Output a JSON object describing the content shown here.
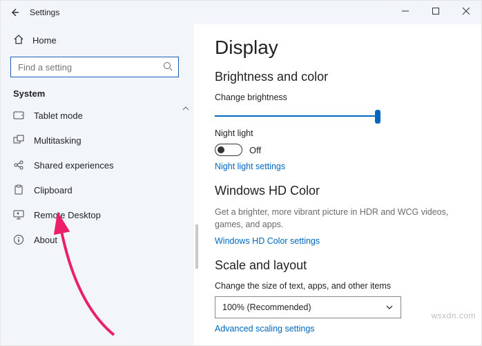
{
  "titlebar": {
    "title": "Settings"
  },
  "left": {
    "home_label": "Home",
    "search_placeholder": "Find a setting",
    "category_label": "System",
    "items": [
      {
        "label": "Tablet mode"
      },
      {
        "label": "Multitasking"
      },
      {
        "label": "Shared experiences"
      },
      {
        "label": "Clipboard"
      },
      {
        "label": "Remote Desktop"
      },
      {
        "label": "About"
      }
    ]
  },
  "main": {
    "page_title": "Display",
    "section1_title": "Brightness and color",
    "brightness_label": "Change brightness",
    "nightlight_label": "Night light",
    "nightlight_state": "Off",
    "nightlight_link": "Night light settings",
    "section2_title": "Windows HD Color",
    "hd_desc": "Get a brighter, more vibrant picture in HDR and WCG videos, games, and apps.",
    "hd_link": "Windows HD Color settings",
    "section3_title": "Scale and layout",
    "scale_label": "Change the size of text, apps, and other items",
    "scale_value": "100% (Recommended)",
    "adv_scaling_link": "Advanced scaling settings"
  },
  "watermark": "wsxdn.com"
}
